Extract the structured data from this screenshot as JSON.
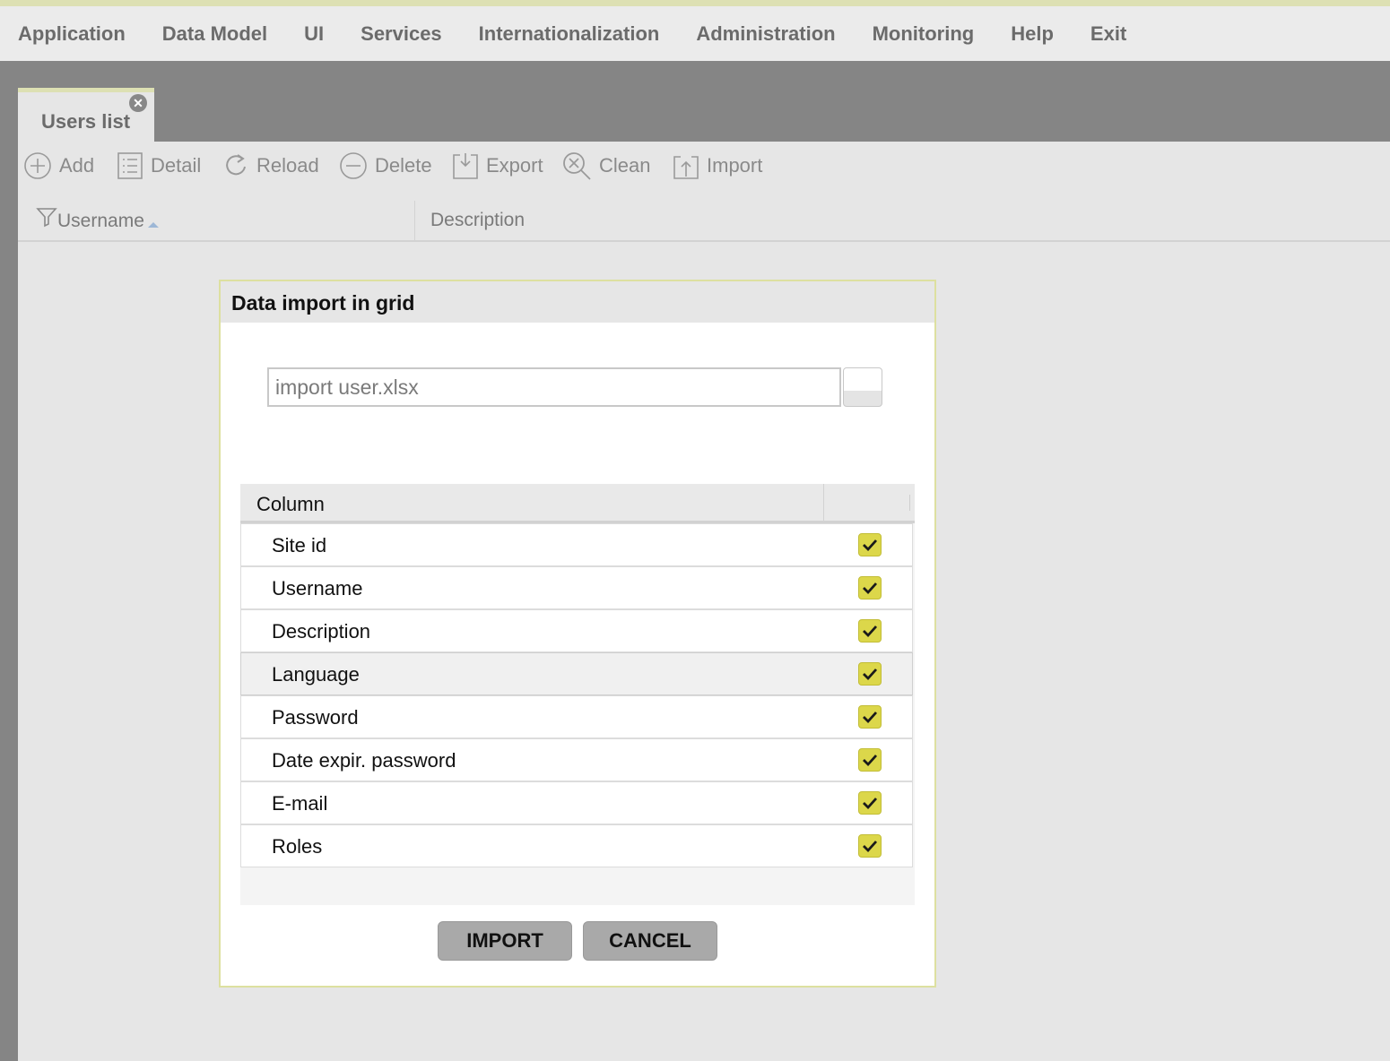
{
  "menu": [
    "Application",
    "Data Model",
    "UI",
    "Services",
    "Internationalization",
    "Administration",
    "Monitoring",
    "Help",
    "Exit"
  ],
  "tab": {
    "label": "Users list",
    "close_icon": "close-icon"
  },
  "toolbar": {
    "add": "Add",
    "detail": "Detail",
    "reload": "Reload",
    "delete": "Delete",
    "export": "Export",
    "clean": "Clean",
    "import": "Import"
  },
  "grid": {
    "username_header": "Username",
    "description_header": "Description"
  },
  "dialog": {
    "title": "Data import in grid",
    "file_value": "import user.xlsx",
    "column_header": "Column",
    "rows": [
      {
        "label": "Site id",
        "checked": true
      },
      {
        "label": "Username",
        "checked": true
      },
      {
        "label": "Description",
        "checked": true
      },
      {
        "label": "Language",
        "checked": true
      },
      {
        "label": "Password",
        "checked": true
      },
      {
        "label": "Date expir. password",
        "checked": true
      },
      {
        "label": "E-mail",
        "checked": true
      },
      {
        "label": "Roles",
        "checked": true
      }
    ],
    "import_button": "IMPORT",
    "cancel_button": "CANCEL"
  },
  "colors": {
    "accent": "#dcd74a",
    "top_stripe": "#dde0b3",
    "backdrop": "#858585"
  }
}
